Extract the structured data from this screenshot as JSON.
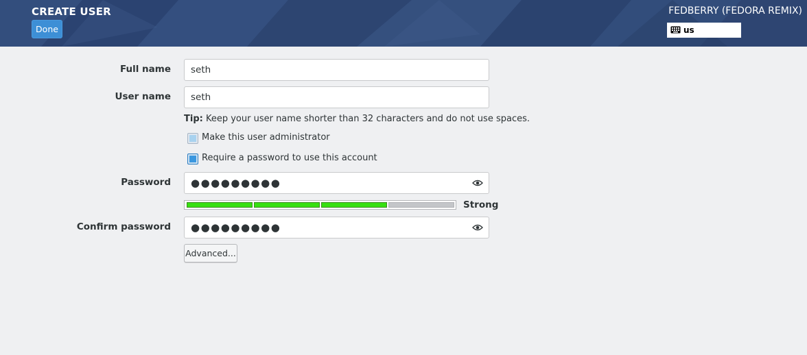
{
  "header": {
    "title": "CREATE USER",
    "done_label": "Done",
    "product": "FEDBERRY (FEDORA REMIX)",
    "keyboard_layout": "us",
    "keyboard_icon": "keyboard-icon"
  },
  "form": {
    "full_name_label": "Full name",
    "full_name_value": "seth",
    "user_name_label": "User name",
    "user_name_value": "seth",
    "tip_prefix": "Tip:",
    "tip_text": " Keep your user name shorter than 32 characters and do not use spaces.",
    "admin_label": "Make this user administrator",
    "admin_checked": false,
    "require_password_label": "Require a password to use this account",
    "require_password_checked": true,
    "password_label": "Password",
    "password_value": "●●●●●●●●●",
    "confirm_label": "Confirm password",
    "confirm_value": "●●●●●●●●●",
    "strength_label": "Strong",
    "strength_fraction": 0.75,
    "advanced_label": "Advanced..."
  },
  "colors": {
    "header_bg": "#2f4775",
    "done_button": "#3d8fd6",
    "strength_fill": "#36e011",
    "strength_empty": "#c4c6c9",
    "checkbox_checked": "#3a97df"
  }
}
